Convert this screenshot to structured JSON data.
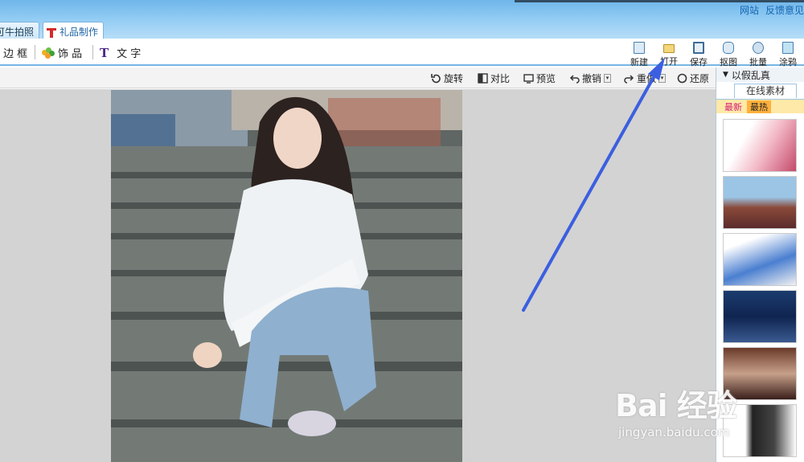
{
  "window": {
    "top_links": [
      "网站",
      "反馈意见"
    ],
    "tabs": [
      {
        "label": "可牛拍照",
        "active": false
      },
      {
        "label": "礼品制作",
        "active": true
      }
    ]
  },
  "toolbar": {
    "left": [
      {
        "label": "边 框",
        "icon": "frame-icon"
      },
      {
        "label": "饰 品",
        "icon": "clover-icon"
      },
      {
        "label": "文 字",
        "icon": "text-t-icon"
      }
    ],
    "right": [
      {
        "label": "新建",
        "icon": "new-document-icon"
      },
      {
        "label": "打开",
        "icon": "open-folder-icon"
      },
      {
        "label": "保存",
        "icon": "save-disk-icon"
      },
      {
        "label": "抠图",
        "icon": "cutout-icon"
      },
      {
        "label": "批量",
        "icon": "batch-gear-icon"
      },
      {
        "label": "涂鸦",
        "icon": "doodle-icon"
      }
    ]
  },
  "edit_bar": {
    "items": [
      {
        "label": "旋转",
        "icon": "rotate-icon",
        "dropdown": false
      },
      {
        "label": "对比",
        "icon": "compare-icon",
        "dropdown": false
      },
      {
        "label": "预览",
        "icon": "preview-icon",
        "dropdown": false
      },
      {
        "label": "撤销",
        "icon": "undo-icon",
        "dropdown": true
      },
      {
        "label": "重做",
        "icon": "redo-icon",
        "dropdown": true
      },
      {
        "label": "还原",
        "icon": "restore-icon",
        "dropdown": false
      }
    ]
  },
  "side_panel": {
    "header": "以假乱真",
    "tab": "在线素材",
    "subtabs": [
      "最新",
      "最热"
    ],
    "thumbnail_count": 6
  },
  "watermark": {
    "logo_text": "Bai 经验",
    "url": "jingyan.baidu.com"
  },
  "colors": {
    "titlebar": "#8fcaf3",
    "accent": "#3b5fe0",
    "canvas_bg": "#d3d3d3"
  }
}
